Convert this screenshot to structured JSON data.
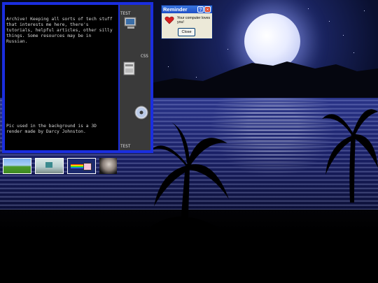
{
  "main_window": {
    "description_lines": [
      "Archive! Keeping all sorts of tech stuff",
      "that interests me here, there's",
      "tutorials, helpful articles, other silly",
      "things. Some resources may be in",
      "Russian."
    ],
    "credit_lines": [
      "Pic used in the background is a 3D",
      "render made by Darcy Johnston."
    ]
  },
  "sidebar": {
    "items": [
      {
        "label": "TEST",
        "icon": "computer-icon"
      },
      {
        "label": "CSS",
        "icon": "disk-drive-icon"
      },
      {
        "label": "",
        "icon": "cd-disc-icon"
      },
      {
        "label": "TEST",
        "icon": ""
      }
    ]
  },
  "dialog": {
    "title": "Reminder",
    "message": "Your computer loves you!",
    "close_label": "Close",
    "icon": "heart-icon",
    "title_buttons": [
      "?",
      "×"
    ]
  },
  "thumbnails": [
    {
      "name": "bliss-thumbnail"
    },
    {
      "name": "room-thumbnail"
    },
    {
      "name": "nyan-cat-thumbnail"
    },
    {
      "name": "cat-thumbnail"
    }
  ],
  "colors": {
    "window_border": "#1a2ee0",
    "sidebar_bg": "#3a3a3a",
    "dialog_title": "#1f4fc6"
  }
}
